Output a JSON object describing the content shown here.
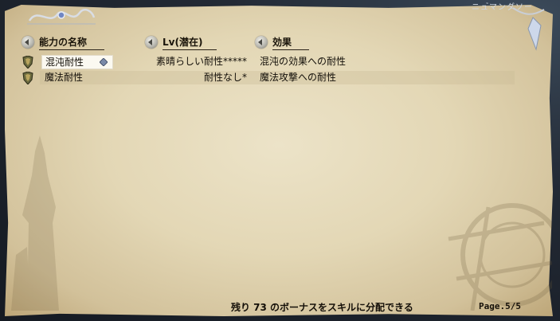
{
  "window": {
    "corner_text": "ニュ゙マンダソー"
  },
  "columns": {
    "name": "能力の名称",
    "level": "Lv(潜在)",
    "effect": "効果"
  },
  "skills": [
    {
      "name": "混沌耐性",
      "level": "素晴らしい耐性*****",
      "effect": "混沌の効果への耐性",
      "selected": true
    },
    {
      "name": "魔法耐性",
      "level": "耐性なし*",
      "effect": "魔法攻撃への耐性",
      "selected": false
    }
  ],
  "footer": {
    "bonus_text": "残り 73 のボーナスをスキルに分配できる",
    "page": "Page.5/5"
  }
}
